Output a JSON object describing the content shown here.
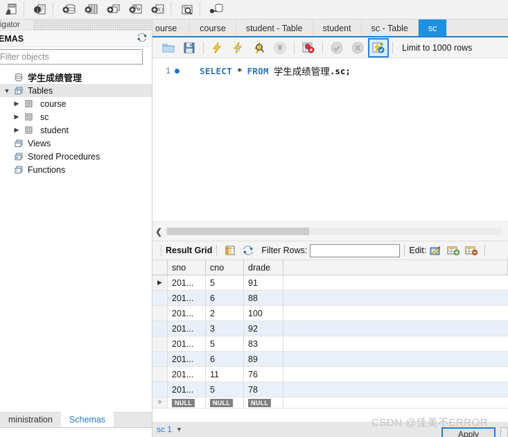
{
  "main_toolbar": {
    "icons": [
      {
        "name": "new-sql-tab-icon",
        "glyph": "sql-file"
      },
      {
        "name": "server-info-icon",
        "glyph": "info"
      },
      {
        "name": "create-schema-icon",
        "glyph": "db-plus"
      },
      {
        "name": "create-table-icon",
        "glyph": "table-plus"
      },
      {
        "name": "create-view-icon",
        "glyph": "view-plus"
      },
      {
        "name": "create-procedure-icon",
        "glyph": "proc-plus"
      },
      {
        "name": "create-function-icon",
        "glyph": "func-plus"
      },
      {
        "name": "search-data-icon",
        "glyph": "magnify-table"
      },
      {
        "name": "reconnect-server-icon",
        "glyph": "db-plug"
      }
    ]
  },
  "navigator": {
    "title": "igator",
    "section_label": "EMAS",
    "refresh_icon": "refresh-icon",
    "filter_placeholder": "Filter objects",
    "tree": [
      {
        "label": "学生成绩管理",
        "icon": "schema-icon",
        "level": 0,
        "arrow": "",
        "selected": false,
        "bold": true
      },
      {
        "label": "Tables",
        "icon": "folder-tables-icon",
        "level": 0,
        "arrow": "▼",
        "selected": true,
        "bold": false
      },
      {
        "label": "course",
        "icon": "table-icon",
        "level": 1,
        "arrow": "▶",
        "selected": false,
        "bold": false
      },
      {
        "label": "sc",
        "icon": "table-icon",
        "level": 1,
        "arrow": "▶",
        "selected": false,
        "bold": false
      },
      {
        "label": "student",
        "icon": "table-icon",
        "level": 1,
        "arrow": "▶",
        "selected": false,
        "bold": false
      },
      {
        "label": "Views",
        "icon": "folder-views-icon",
        "level": 0,
        "arrow": "",
        "selected": false,
        "bold": false
      },
      {
        "label": "Stored Procedures",
        "icon": "folder-procs-icon",
        "level": 0,
        "arrow": "",
        "selected": false,
        "bold": false
      },
      {
        "label": "Functions",
        "icon": "folder-funcs-icon",
        "level": 0,
        "arrow": "",
        "selected": false,
        "bold": false
      }
    ],
    "bottom_tabs": [
      {
        "label": "ministration",
        "active": false
      },
      {
        "label": "Schemas",
        "active": true
      }
    ]
  },
  "editor_tabs": [
    {
      "label": "ourse",
      "active": false
    },
    {
      "label": "course",
      "active": false
    },
    {
      "label": "student - Table",
      "active": false
    },
    {
      "label": "student",
      "active": false
    },
    {
      "label": "sc - Table",
      "active": false
    },
    {
      "label": "sc",
      "active": true
    }
  ],
  "sql_toolbar": {
    "icons": [
      {
        "name": "open-sql-script-icon",
        "glyph": "folder"
      },
      {
        "name": "save-sql-script-icon",
        "glyph": "floppy"
      },
      {
        "name": "execute-statement-icon",
        "glyph": "bolt"
      },
      {
        "name": "execute-current-statement-icon",
        "glyph": "bolt-cursor"
      },
      {
        "name": "explain-statement-icon",
        "glyph": "bolt-magnify"
      },
      {
        "name": "stop-execution-icon",
        "glyph": "hand"
      },
      {
        "name": "toggle-stop-on-error-icon",
        "glyph": "stop-error"
      },
      {
        "name": "commit-icon",
        "glyph": "check"
      },
      {
        "name": "rollback-icon",
        "glyph": "cross"
      },
      {
        "name": "toggle-autocommit-icon",
        "glyph": "autocommit"
      }
    ],
    "limit_label": "Limit to 1000 rows"
  },
  "sql_editor": {
    "line_number": "1",
    "keyword_select": "SELECT",
    "star": "*",
    "keyword_from": "FROM",
    "schema_name": "学生成绩管理",
    "object_ref": ".sc;"
  },
  "grid_toolbar": {
    "result_grid_label": "Result Grid",
    "form_editor_icon": "form-editor-icon",
    "refresh_icon": "refresh-grid-icon",
    "filter_rows_label": "Filter Rows:",
    "filter_rows_value": "",
    "edit_label": "Edit:",
    "edit_icons": [
      {
        "name": "edit-row-icon",
        "glyph": "pencil"
      },
      {
        "name": "insert-row-icon",
        "glyph": "table-plus"
      },
      {
        "name": "delete-row-icon",
        "glyph": "table-minus"
      }
    ]
  },
  "result_grid": {
    "columns": [
      "sno",
      "cno",
      "drade"
    ],
    "rows": [
      {
        "marker": "▶",
        "sno": "201...",
        "cno": "5",
        "drade": "91"
      },
      {
        "marker": "",
        "sno": "201...",
        "cno": "6",
        "drade": "88"
      },
      {
        "marker": "",
        "sno": "201...",
        "cno": "2",
        "drade": "100"
      },
      {
        "marker": "",
        "sno": "201...",
        "cno": "3",
        "drade": "92"
      },
      {
        "marker": "",
        "sno": "201...",
        "cno": "5",
        "drade": "83"
      },
      {
        "marker": "",
        "sno": "201...",
        "cno": "6",
        "drade": "89"
      },
      {
        "marker": "",
        "sno": "201...",
        "cno": "11",
        "drade": "76"
      },
      {
        "marker": "",
        "sno": "201...",
        "cno": "5",
        "drade": "78"
      }
    ],
    "new_row": {
      "sno": "NULL",
      "cno": "NULL",
      "drade": "NULL"
    }
  },
  "bottom": {
    "result_tab": "sc 1",
    "apply_label": "Apply",
    "watermark": "CSDN @佳美不ERROR"
  },
  "colors": {
    "accent_blue": "#1e90e0",
    "keyword_blue": "#2e74b5",
    "row_alt": "#e9f0f9",
    "selection_gray": "#e6e6e6"
  }
}
